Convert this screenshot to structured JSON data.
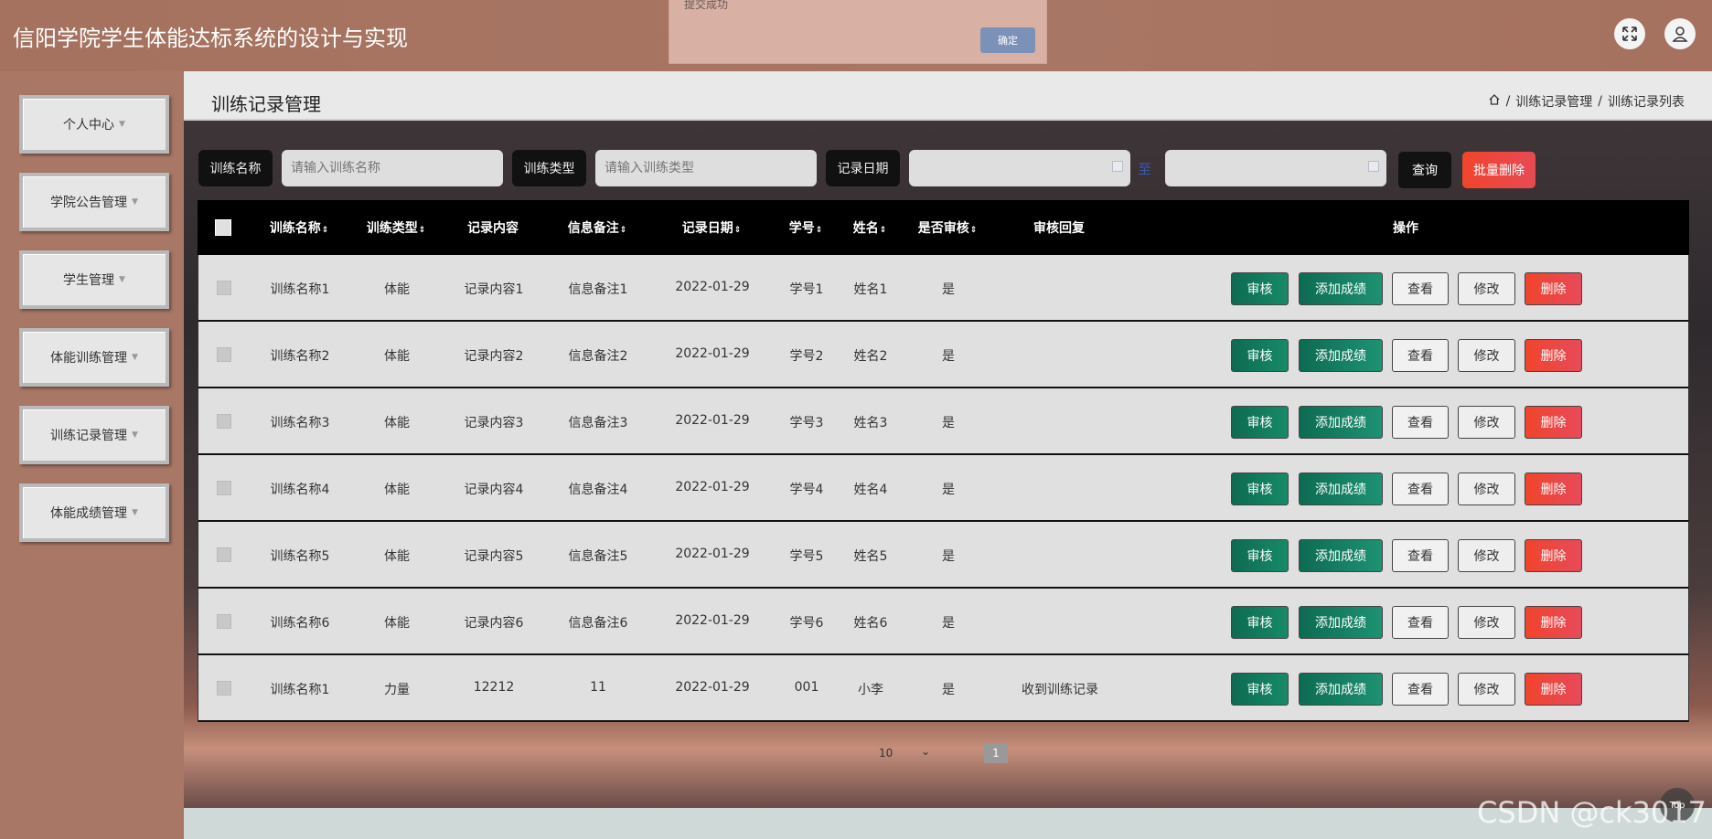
{
  "app": {
    "title": "信阳学院学生体能达标系统的设计与实现"
  },
  "toast": {
    "message": "提交成功",
    "confirm": "确定"
  },
  "sidebar": {
    "items": [
      {
        "label": "个人中心"
      },
      {
        "label": "学院公告管理"
      },
      {
        "label": "学生管理"
      },
      {
        "label": "体能训练管理"
      },
      {
        "label": "训练记录管理"
      },
      {
        "label": "体能成绩管理"
      }
    ]
  },
  "header": {
    "title": "训练记录管理",
    "breadcrumb": [
      "训练记录管理",
      "训练记录列表"
    ]
  },
  "search": {
    "name_label": "训练名称",
    "name_placeholder": "请输入训练名称",
    "type_label": "训练类型",
    "type_placeholder": "请输入训练类型",
    "date_label": "记录日期",
    "range_sep": "至",
    "query": "查询",
    "batch_delete": "批量删除"
  },
  "table": {
    "columns": [
      "训练名称",
      "训练类型",
      "记录内容",
      "信息备注",
      "记录日期",
      "学号",
      "姓名",
      "是否审核",
      "审核回复",
      "操作"
    ],
    "actions": {
      "audit": "审核",
      "add_score": "添加成绩",
      "view": "查看",
      "edit": "修改",
      "delete": "删除"
    },
    "rows": [
      {
        "name": "训练名称1",
        "type": "体能",
        "content": "记录内容1",
        "remark": "信息备注1",
        "date": "2022-01-29",
        "sid": "学号1",
        "sname": "姓名1",
        "audited": "是",
        "reply": ""
      },
      {
        "name": "训练名称2",
        "type": "体能",
        "content": "记录内容2",
        "remark": "信息备注2",
        "date": "2022-01-29",
        "sid": "学号2",
        "sname": "姓名2",
        "audited": "是",
        "reply": ""
      },
      {
        "name": "训练名称3",
        "type": "体能",
        "content": "记录内容3",
        "remark": "信息备注3",
        "date": "2022-01-29",
        "sid": "学号3",
        "sname": "姓名3",
        "audited": "是",
        "reply": ""
      },
      {
        "name": "训练名称4",
        "type": "体能",
        "content": "记录内容4",
        "remark": "信息备注4",
        "date": "2022-01-29",
        "sid": "学号4",
        "sname": "姓名4",
        "audited": "是",
        "reply": ""
      },
      {
        "name": "训练名称5",
        "type": "体能",
        "content": "记录内容5",
        "remark": "信息备注5",
        "date": "2022-01-29",
        "sid": "学号5",
        "sname": "姓名5",
        "audited": "是",
        "reply": ""
      },
      {
        "name": "训练名称6",
        "type": "体能",
        "content": "记录内容6",
        "remark": "信息备注6",
        "date": "2022-01-29",
        "sid": "学号6",
        "sname": "姓名6",
        "audited": "是",
        "reply": ""
      },
      {
        "name": "训练名称1",
        "type": "力量",
        "content": "12212",
        "remark": "11",
        "date": "2022-01-29",
        "sid": "001",
        "sname": "小李",
        "audited": "是",
        "reply": "收到训练记录"
      }
    ]
  },
  "pager": {
    "page_size": "10",
    "current_page": "1"
  },
  "watermark": "CSDN @ck3017",
  "top_button": "Top"
}
